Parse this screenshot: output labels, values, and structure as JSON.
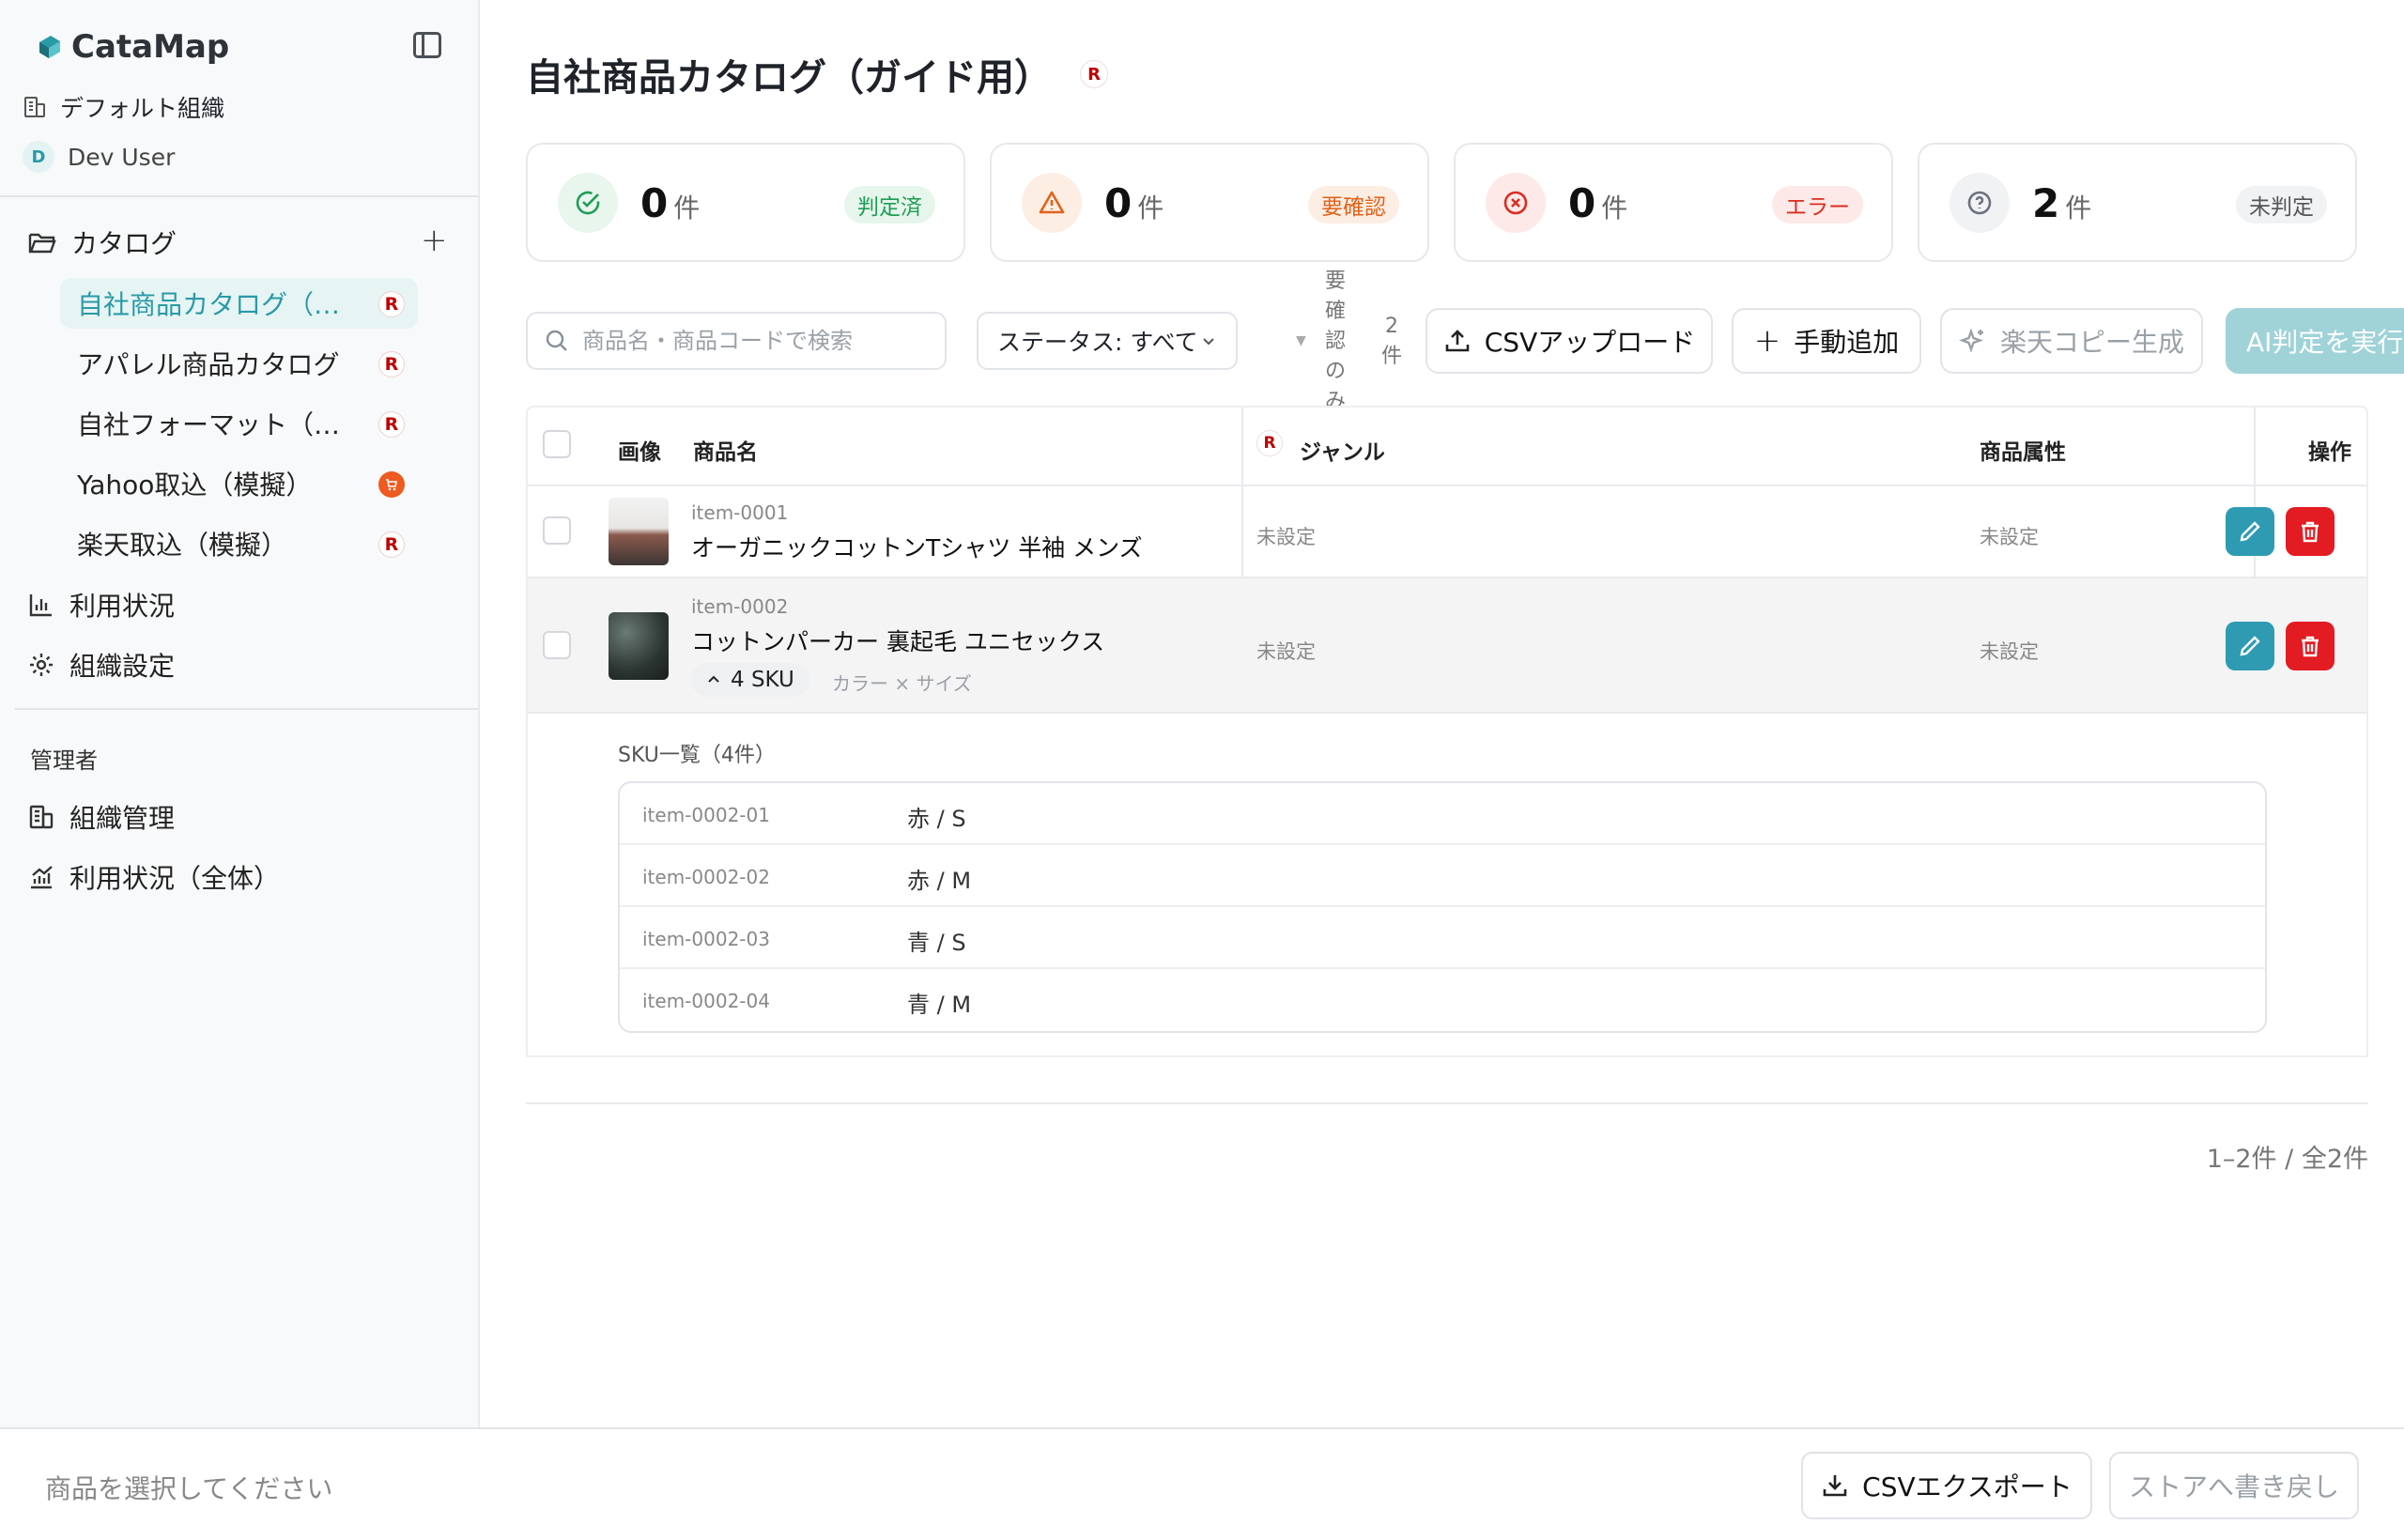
{
  "app": {
    "name": "CataMap",
    "org": "デフォルト組織",
    "user_initial": "D",
    "user": "Dev User"
  },
  "sidebar": {
    "catalog_label": "カタログ",
    "catalogs": [
      {
        "label": "自社商品カタログ（ガイド用）",
        "badge": "R",
        "active": true
      },
      {
        "label": "アパレル商品カタログ",
        "badge": "R"
      },
      {
        "label": "自社フォーマット（サンプル）",
        "badge": "R"
      },
      {
        "label": "Yahoo取込（模擬）",
        "badge": "yahoo"
      },
      {
        "label": "楽天取込（模擬）",
        "badge": "R"
      }
    ],
    "usage": "利用状況",
    "org_settings": "組織設定",
    "admin_label": "管理者",
    "org_management": "組織管理",
    "usage_all": "利用状況（全体）"
  },
  "header": {
    "title": "自社商品カタログ（ガイド用）",
    "badge": "R"
  },
  "stats": [
    {
      "count": "0",
      "unit": "件",
      "tag": "判定済",
      "color": "#1f9d55"
    },
    {
      "count": "0",
      "unit": "件",
      "tag": "要確認",
      "color": "#e2621b"
    },
    {
      "count": "0",
      "unit": "件",
      "tag": "エラー",
      "color": "#d92d20"
    },
    {
      "count": "2",
      "unit": "件",
      "tag": "未判定",
      "color": "#6b7280"
    }
  ],
  "toolbar": {
    "search_placeholder": "商品名・商品コードで検索",
    "status_select": "ステータス: すべて",
    "review_only": "要確認のみ",
    "count_label": "2件",
    "csv_upload": "CSVアップロード",
    "manual_add": "手動追加",
    "rakuten_copy": "楽天コピー生成",
    "ai_judge": "AI判定を実行"
  },
  "table": {
    "headers": {
      "image": "画像",
      "name": "商品名",
      "genre": "ジャンル",
      "attrs": "商品属性",
      "actions": "操作"
    },
    "rows": [
      {
        "code": "item-0001",
        "name": "オーガニックコットンTシャツ 半袖 メンズ",
        "genre": "未設定",
        "attrs": "未設定"
      },
      {
        "code": "item-0002",
        "name": "コットンパーカー 裏起毛 ユニセックス",
        "genre": "未設定",
        "attrs": "未設定",
        "sku_chip": "4 SKU",
        "sku_attrs": "カラー × サイズ"
      }
    ]
  },
  "sku": {
    "title": "SKU一覧（4件）",
    "items": [
      {
        "code": "item-0002-01",
        "variant": "赤 / S"
      },
      {
        "code": "item-0002-02",
        "variant": "赤 / M"
      },
      {
        "code": "item-0002-03",
        "variant": "青 / S"
      },
      {
        "code": "item-0002-04",
        "variant": "青 / M"
      }
    ]
  },
  "pagination": "1–2件 / 全2件",
  "footer": {
    "message": "商品を選択してください",
    "csv_export": "CSVエクスポート",
    "write_back": "ストアへ書き戻し"
  }
}
